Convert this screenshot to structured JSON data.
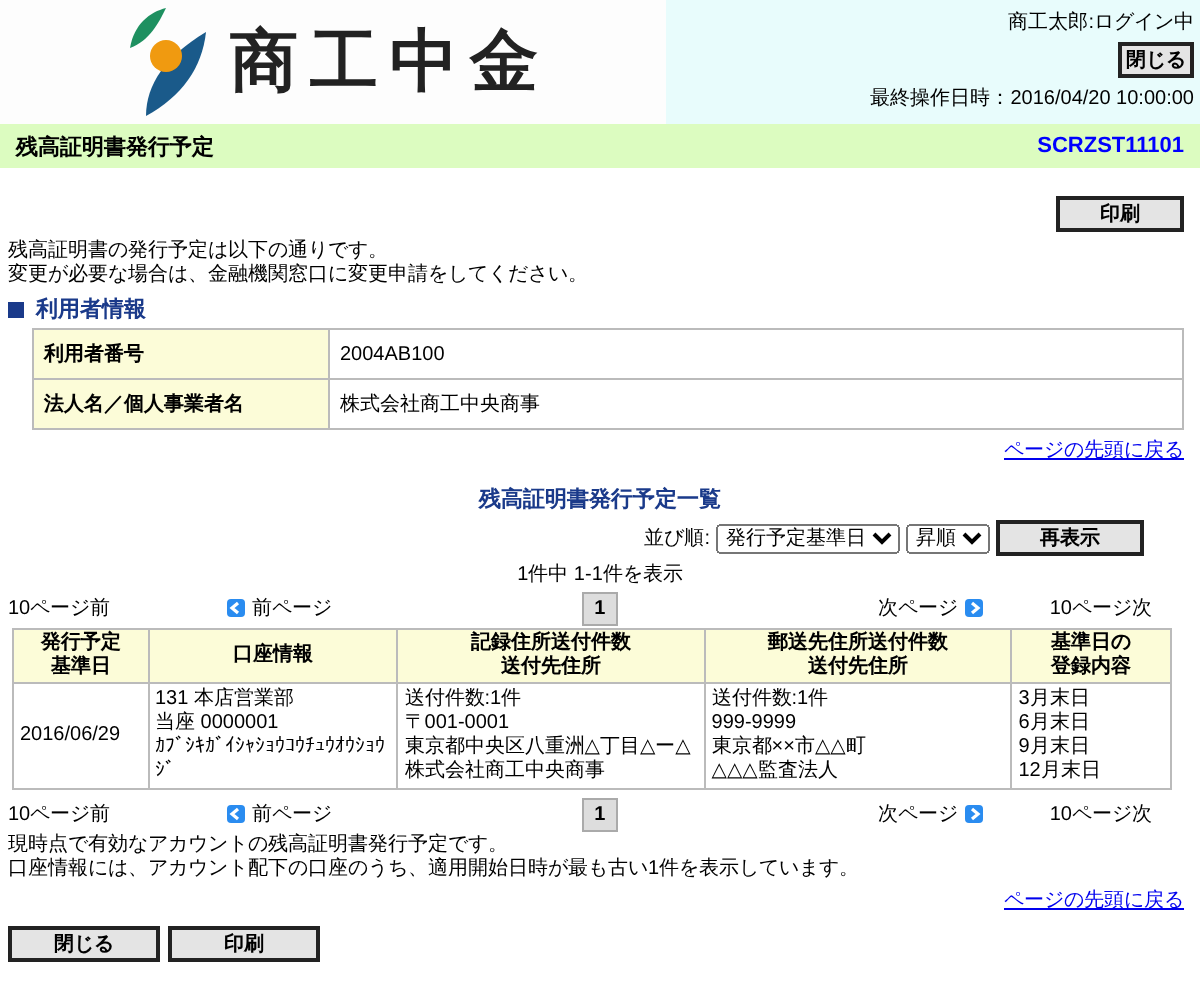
{
  "header": {
    "logo_text": "商工中金",
    "user": "商工太郎:ログイン中",
    "close_button": "閉じる",
    "last_operation": "最終操作日時：2016/04/20 10:00:00"
  },
  "title_bar": {
    "title": "残高証明書発行予定",
    "screen_id": "SCRZST11101"
  },
  "print_button": "印刷",
  "intro": [
    "残高証明書の発行予定は以下の通りです。",
    "変更が必要な場合は、金融機関窓口に変更申請をしてください。"
  ],
  "user_info": {
    "heading": "利用者情報",
    "rows": [
      {
        "label": "利用者番号",
        "value": "2004AB100"
      },
      {
        "label": "法人名／個人事業者名",
        "value": "株式会社商工中央商事"
      }
    ]
  },
  "top_link_1": "ページの先頭に戻る",
  "list": {
    "heading": "残高証明書発行予定一覧",
    "sort_label": "並び順:",
    "sort_field": "発行予定基準日",
    "sort_order": "昇順",
    "redisplay_button": "再表示",
    "count": "1件中 1-1件を表示",
    "pagers": [
      {
        "prev10": "10ページ前",
        "prev": "前ページ",
        "pages": [
          {
            "label": "1",
            "selected": true
          }
        ],
        "next": "次ページ",
        "next10": "10ページ次"
      },
      {
        "prev10": "10ページ前",
        "prev": "前ページ",
        "pages": [
          {
            "label": "1",
            "selected": true
          }
        ],
        "next": "次ページ",
        "next10": "10ページ次"
      }
    ],
    "columns": [
      "発行予定基準日",
      "口座情報",
      "記録住所送付件数送付先住所",
      "郵送先住所送付件数送付先住所",
      "基準日の登録内容"
    ],
    "rows": [
      [
        [
          "2016/06/29"
        ],
        [
          "131 本店営業部",
          "当座 0000001",
          "ｶﾌﾞｼｷｶﾞｲｼｬｼｮｳｺｳﾁｭｳｵｳｼｮｳ",
          "ｼﾞ"
        ],
        [
          "送付件数:1件",
          "〒001-0001",
          "東京都中央区八重洲△丁目△ー△",
          "株式会社商工中央商事"
        ],
        [
          "送付件数:1件",
          "999-9999",
          "東京都××市△△町",
          "△△△監査法人"
        ],
        [
          "3月末日",
          "6月末日",
          "9月末日",
          "12月末日"
        ]
      ]
    ]
  },
  "notes": [
    "現時点で有効なアカウントの残高証明書発行予定です。",
    "口座情報には、アカウント配下の口座のうち、適用開始日時が最も古い1件を表示しています。"
  ],
  "top_link_2": "ページの先頭に戻る",
  "bottom_buttons": [
    "閉じる",
    "印刷"
  ]
}
